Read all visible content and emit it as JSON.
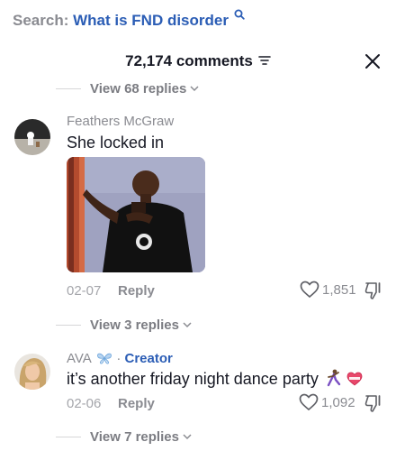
{
  "search": {
    "prefix": "Search:",
    "query": "What is FND disorder",
    "icon": "search-icon"
  },
  "header": {
    "count_label": "72,174 comments",
    "filter_icon": "filter-icon",
    "close_icon": "close-icon"
  },
  "replies": {
    "top": "View 68 replies",
    "comment1": "View 3 replies",
    "comment2": "View 7 replies"
  },
  "comments": [
    {
      "author": "Feathers McGraw",
      "text": "She locked in",
      "media": "gif-dancing-man",
      "date": "02-07",
      "reply_label": "Reply",
      "likes": "1,851"
    },
    {
      "author": "AVA",
      "badge_separator": "·",
      "badge": "Creator",
      "text": "it’s another friday night dance party",
      "date": "02-06",
      "reply_label": "Reply",
      "likes": "1,092"
    }
  ],
  "colors": {
    "link_blue": "#2b5db5",
    "muted": "#8a8b91",
    "text": "#161823"
  }
}
